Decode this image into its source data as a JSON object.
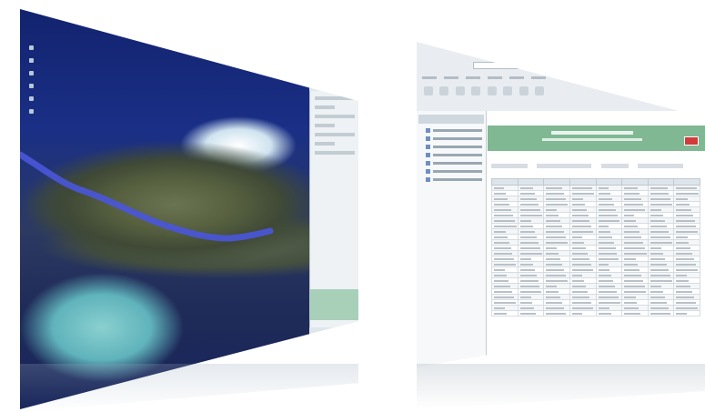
{
  "scene": {
    "description_free": true
  },
  "map_window": {
    "nav_buttons": [
      "zoom-in",
      "zoom-out",
      "pan-up",
      "pan-down",
      "pan-left",
      "pan-right"
    ],
    "route_color": "#4a56d8",
    "sidebar_rows": 7
  },
  "browser_window": {
    "menu": [
      "File",
      "Edit",
      "View",
      "Favorites",
      "Tools",
      "Help"
    ],
    "toolbar_buttons": 8,
    "tree_items": 7,
    "header_color": "#7fb893",
    "close_button_color": "#d23b3b",
    "table": {
      "columns": 8,
      "rows": 24
    }
  },
  "colors": {
    "ocean": "#1a2f86",
    "shallow_water": "#5fb3bb",
    "land": "#56603f",
    "panel": "#eef2f4",
    "accent_green": "#a8d0b8"
  }
}
